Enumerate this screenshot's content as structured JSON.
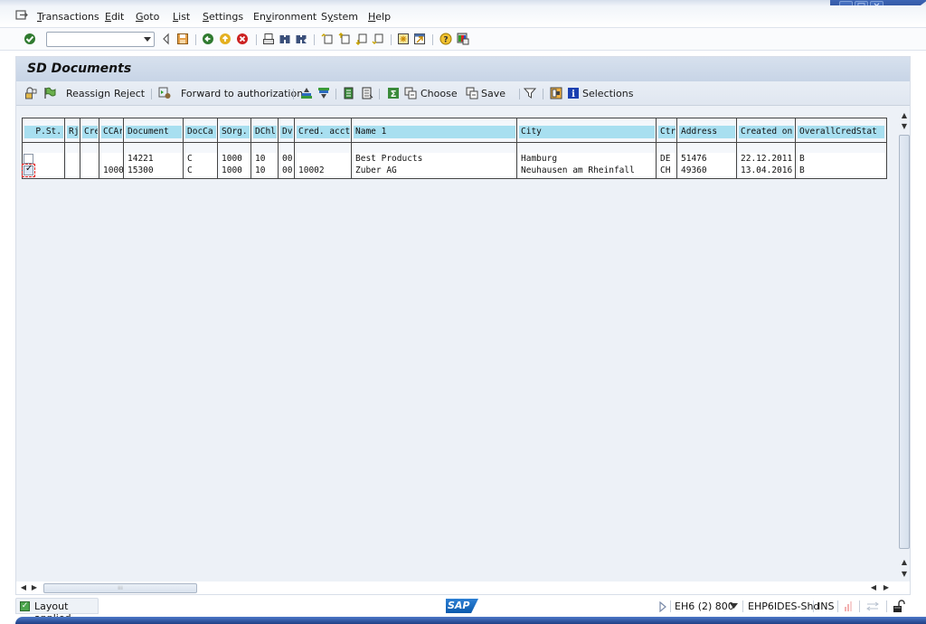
{
  "menubar": {
    "items": [
      {
        "label": "Transactions",
        "mnemonic": "T"
      },
      {
        "label": "Edit",
        "mnemonic": "E"
      },
      {
        "label": "Goto",
        "mnemonic": "G"
      },
      {
        "label": "List",
        "mnemonic": "L"
      },
      {
        "label": "Settings",
        "mnemonic": "S"
      },
      {
        "label": "Environment",
        "mnemonic": "v"
      },
      {
        "label": "System",
        "mnemonic": "y"
      },
      {
        "label": "Help",
        "mnemonic": "H"
      }
    ]
  },
  "window_controls": {
    "minimize": "_",
    "maximize": "□",
    "close": "✕"
  },
  "std_toolbar": {
    "command_field": {
      "value": "",
      "placeholder": ""
    },
    "icons": [
      "enter-icon",
      "command-dropdown-icon",
      "collapse-arrow-icon",
      "save-icon",
      "back-icon",
      "exit-icon",
      "cancel-icon",
      "print-icon",
      "find-icon",
      "find-next-icon",
      "first-page-icon",
      "previous-page-icon",
      "next-page-icon",
      "last-page-icon",
      "create-session-icon",
      "shortcut-icon",
      "help-icon",
      "customize-layout-icon"
    ]
  },
  "screen": {
    "title": "SD Documents",
    "app_toolbar": {
      "reassign": "Reassign",
      "reject": "Reject",
      "forward": "Forward to authorization",
      "choose": "Choose",
      "save": "Save",
      "selections": "Selections"
    }
  },
  "table": {
    "columns": [
      "P.St.",
      "Rj",
      "Cre",
      "CCAr",
      "Document",
      "DocCa",
      "SOrg.",
      "DChl",
      "Dv",
      "Cred. acct",
      "Name 1",
      "City",
      "Ctr",
      "Address",
      "Created on",
      "OverallCredStat"
    ],
    "rows": [
      {
        "checked": false,
        "rj": "",
        "cre": "",
        "ccar": "",
        "document": "14221",
        "docca": "C",
        "sorg": "1000",
        "dchl": "10",
        "dv": "00",
        "cred_acct": "",
        "name1": "Best Products",
        "city": "Hamburg",
        "ctr": "DE",
        "address": "51476",
        "created_on": "22.12.2011",
        "overall_cred_stat": "B"
      },
      {
        "checked": true,
        "rj": "",
        "cre": "",
        "ccar": "1000",
        "document": "15300",
        "docca": "C",
        "sorg": "1000",
        "dchl": "10",
        "dv": "00",
        "cred_acct": "10002",
        "name1": "Zuber AG",
        "city": "Neuhausen am Rheinfall",
        "ctr": "CH",
        "address": "49360",
        "created_on": "13.04.2016",
        "overall_cred_stat": "B"
      }
    ]
  },
  "statusbar": {
    "message": "Layout applied",
    "message_type": "success",
    "logo": "SAP",
    "system": "EH6 (2) 800",
    "server": "EHP6IDES-Shd",
    "mode": "INS"
  },
  "colors": {
    "header_cell": "#a8dff0",
    "window_accent": "#2b4f9c",
    "sap_logo": "#0b5aad"
  }
}
